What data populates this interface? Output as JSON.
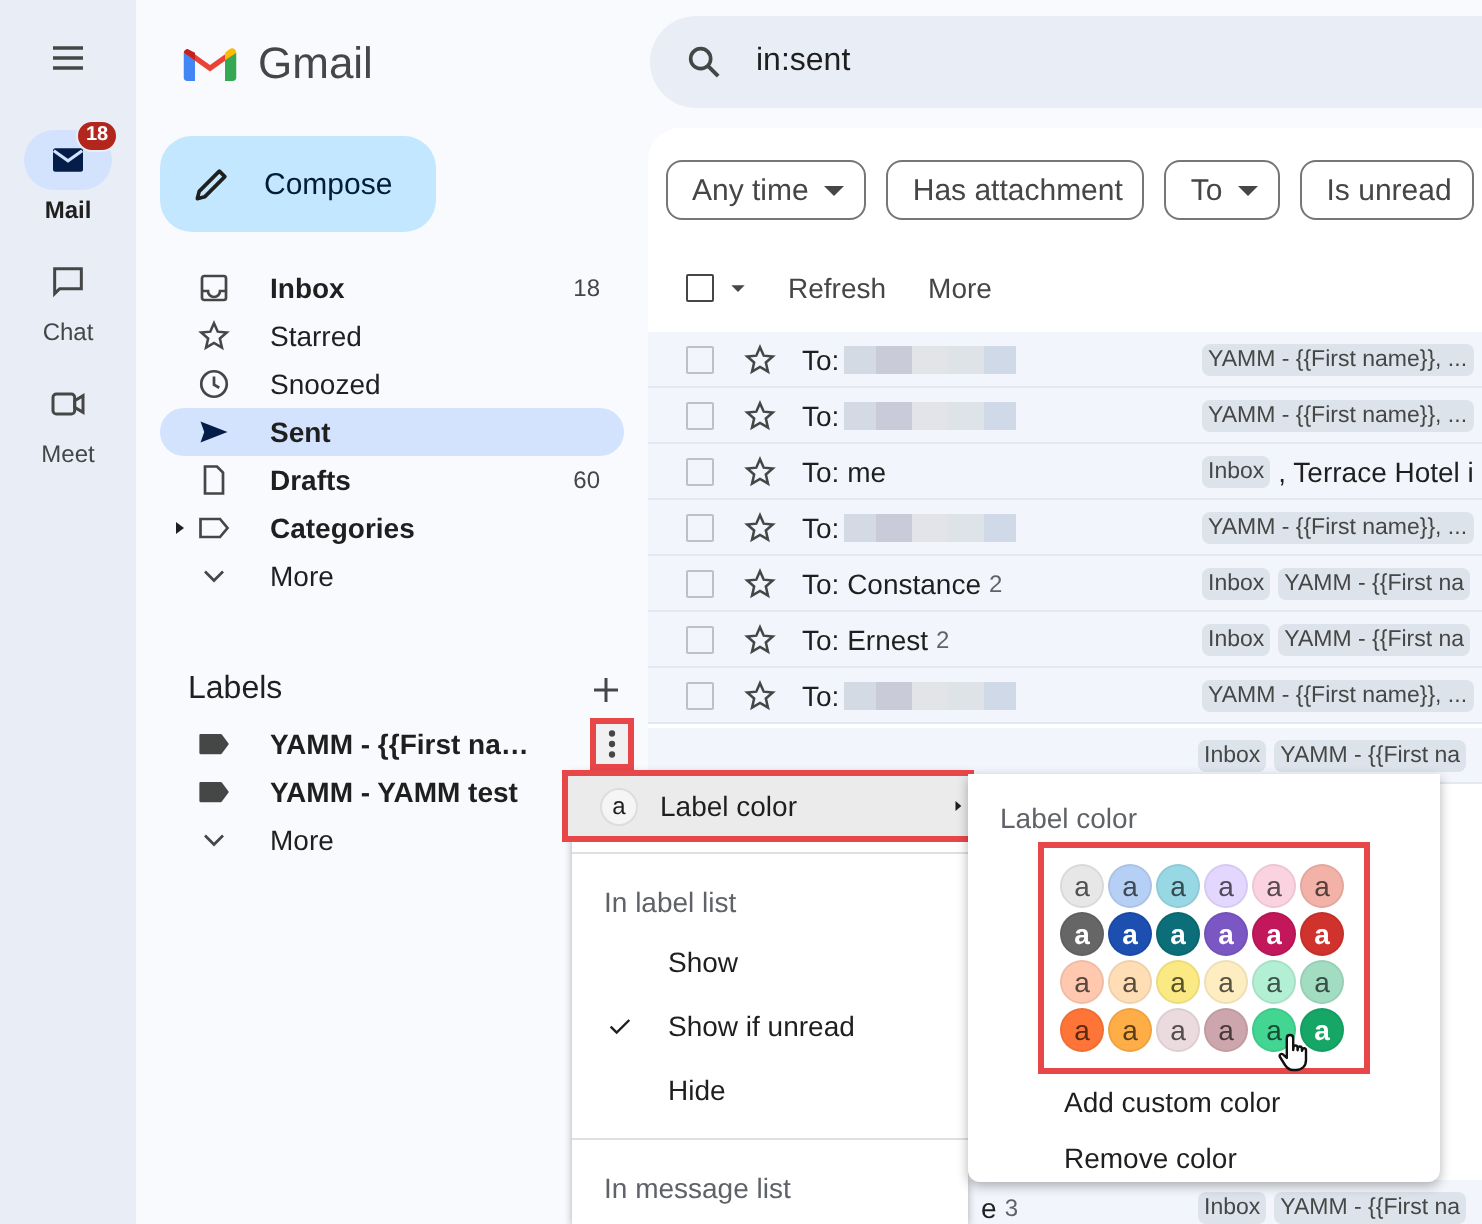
{
  "rail": {
    "items": [
      {
        "label": "Mail",
        "selected": true,
        "badge": "18"
      },
      {
        "label": "Chat",
        "selected": false
      },
      {
        "label": "Meet",
        "selected": false
      }
    ]
  },
  "app": {
    "name": "Gmail"
  },
  "compose": {
    "label": "Compose"
  },
  "nav": [
    {
      "label": "Inbox",
      "count": "18",
      "unread": true,
      "selected": false
    },
    {
      "label": "Starred",
      "unread": false,
      "selected": false
    },
    {
      "label": "Snoozed",
      "unread": false,
      "selected": false
    },
    {
      "label": "Sent",
      "unread": false,
      "selected": true
    },
    {
      "label": "Drafts",
      "count": "60",
      "unread": true,
      "selected": false
    },
    {
      "label": "Categories",
      "unread": true,
      "selected": false,
      "expanded": false
    },
    {
      "label": "More",
      "unread": false,
      "selected": false
    }
  ],
  "labels": {
    "title": "Labels",
    "items": [
      {
        "name": "YAMM - {{First na…",
        "unread": true,
        "highlighted": true
      },
      {
        "name": "YAMM - YAMM test",
        "unread": true
      }
    ],
    "more": "More"
  },
  "search": {
    "value": "in:sent"
  },
  "filters": [
    {
      "label": "Any time",
      "dropdown": true
    },
    {
      "label": "Has attachment",
      "dropdown": false
    },
    {
      "label": "To",
      "dropdown": true
    },
    {
      "label": "Is unread",
      "dropdown": false
    }
  ],
  "toolbar": {
    "select_all_checked": false,
    "actions": [
      "Refresh",
      "More"
    ]
  },
  "rows": [
    {
      "kind": "message",
      "checked": false,
      "recipient": "To:",
      "redacted": true,
      "chips": [
        "YAMM - {{First name}}, ..."
      ]
    },
    {
      "kind": "message",
      "checked": false,
      "recipient": "To:",
      "redacted": true,
      "chips": [
        "YAMM - {{First name}}, ..."
      ]
    },
    {
      "kind": "message",
      "checked": false,
      "recipient": "To: me",
      "redacted": false,
      "chips": [
        "Inbox"
      ],
      "snippet": ", Terrace Hotel i"
    },
    {
      "kind": "message",
      "checked": false,
      "recipient": "To:",
      "redacted": true,
      "chips": [
        "YAMM - {{First name}}, ..."
      ]
    },
    {
      "kind": "message",
      "checked": false,
      "recipient": "To: Constance",
      "count": "2",
      "redacted": false,
      "chips": [
        "Inbox",
        "YAMM - {{First na"
      ]
    },
    {
      "kind": "message",
      "checked": false,
      "recipient": "To: Ernest",
      "count": "2",
      "redacted": false,
      "chips": [
        "Inbox",
        "YAMM - {{First na"
      ]
    },
    {
      "kind": "message",
      "checked": false,
      "recipient": "To:",
      "redacted": true,
      "chips": [
        "YAMM - {{First name}}, ..."
      ]
    },
    {
      "kind": "partial",
      "chips": [
        "Inbox",
        "YAMM - {{First na"
      ]
    },
    {
      "kind": "partial",
      "recipient": "e",
      "count": "3",
      "chips": [
        "Inbox",
        "YAMM - {{First na"
      ]
    }
  ],
  "label_menu": {
    "items": [
      {
        "kind": "submenu",
        "label": "Label color",
        "swatch": "a",
        "highlighted": true
      },
      {
        "kind": "header",
        "label": "In label list"
      },
      {
        "kind": "option",
        "label": "Show",
        "checked": false
      },
      {
        "kind": "option",
        "label": "Show if unread",
        "checked": true
      },
      {
        "kind": "option",
        "label": "Hide",
        "checked": false
      },
      {
        "kind": "header",
        "label": "In message list"
      }
    ]
  },
  "color_menu": {
    "title": "Label color",
    "highlighted": true,
    "swatches": [
      {
        "label": "a",
        "color": "#e7e7e7",
        "hovered": false
      },
      {
        "label": "a",
        "color": "#b6cff5",
        "hovered": false
      },
      {
        "label": "a",
        "color": "#98d7e4",
        "hovered": false
      },
      {
        "label": "a",
        "color": "#e3d7ff",
        "hovered": false
      },
      {
        "label": "a",
        "color": "#fbd3e0",
        "hovered": false
      },
      {
        "label": "a",
        "color": "#f2b2a8",
        "hovered": false
      },
      {
        "label": "a",
        "color": "#666666",
        "hovered": false
      },
      {
        "label": "a",
        "color": "#1c4fb0",
        "hovered": false
      },
      {
        "label": "a",
        "color": "#0b6e78",
        "hovered": false
      },
      {
        "label": "a",
        "color": "#7b57c4",
        "hovered": false
      },
      {
        "label": "a",
        "color": "#c2185b",
        "hovered": false
      },
      {
        "label": "a",
        "color": "#d0322d",
        "hovered": false
      },
      {
        "label": "a",
        "color": "#ffc8af",
        "hovered": false
      },
      {
        "label": "a",
        "color": "#ffdeb5",
        "hovered": false
      },
      {
        "label": "a",
        "color": "#fbe983",
        "hovered": false
      },
      {
        "label": "a",
        "color": "#fdedc1",
        "hovered": false
      },
      {
        "label": "a",
        "color": "#b3efd3",
        "hovered": false
      },
      {
        "label": "a",
        "color": "#a2dcc1",
        "hovered": false
      },
      {
        "label": "a",
        "color": "#ff7537",
        "hovered": false
      },
      {
        "label": "a",
        "color": "#ffad46",
        "hovered": false
      },
      {
        "label": "a",
        "color": "#ebdbde",
        "hovered": false
      },
      {
        "label": "a",
        "color": "#cca6ac",
        "hovered": false
      },
      {
        "label": "a",
        "color": "#42d692",
        "hovered": true
      },
      {
        "label": "a",
        "color": "#16a766",
        "hovered": false
      }
    ],
    "actions": [
      "Add custom color",
      "Remove color"
    ]
  }
}
